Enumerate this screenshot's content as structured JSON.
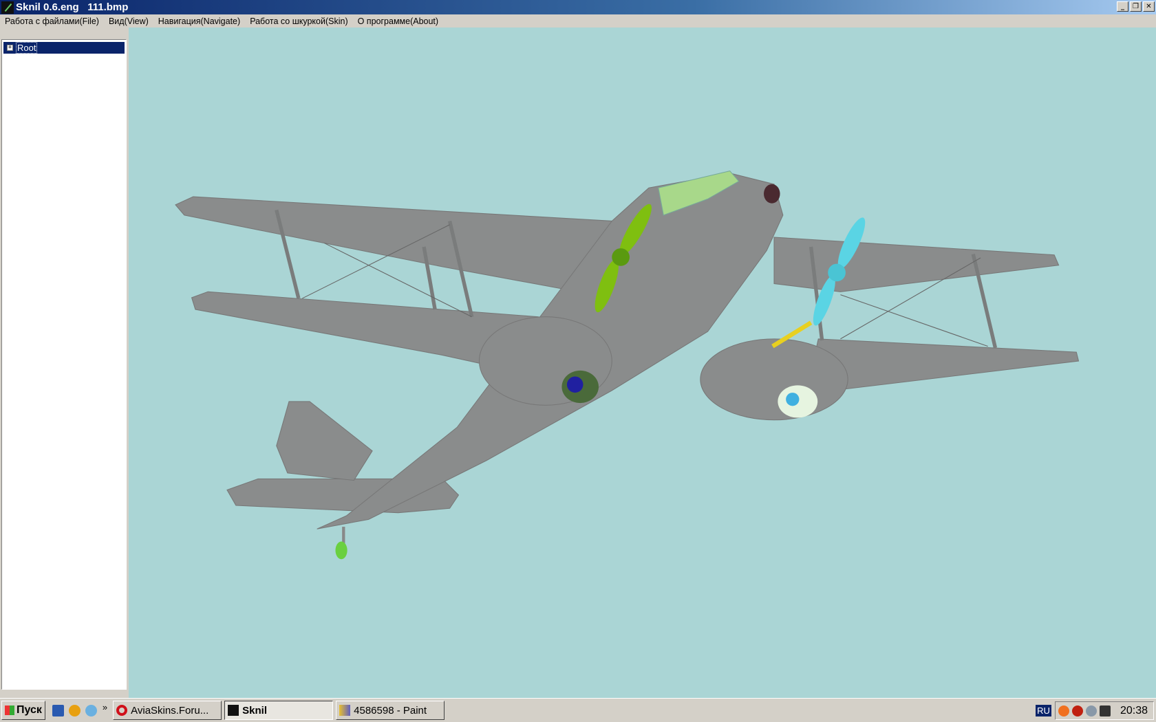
{
  "window": {
    "title": "Sknil 0.6.eng   111.bmp",
    "buttons": [
      "minimize",
      "restore",
      "close"
    ]
  },
  "menu": [
    "Работа с файлами(File)",
    "Вид(View)",
    "Навигация(Navigate)",
    "Работа со шкуркой(Skin)",
    "О программе(About)"
  ],
  "tree": {
    "root_label": "Root",
    "expander": "+"
  },
  "viewport": {
    "background": "#aad5d5",
    "model_color": "#8a8c8c"
  },
  "taskbar": {
    "start_label": "Пуск",
    "overflow": "»",
    "tasks": [
      {
        "label": "AviaSkins.Foru...",
        "icon": "opera-icon"
      },
      {
        "label": "Sknil",
        "icon": "sknil-icon",
        "active": true
      },
      {
        "label": "4586598 - Paint",
        "icon": "paint-icon"
      }
    ],
    "language": "RU",
    "clock": "20:38"
  }
}
